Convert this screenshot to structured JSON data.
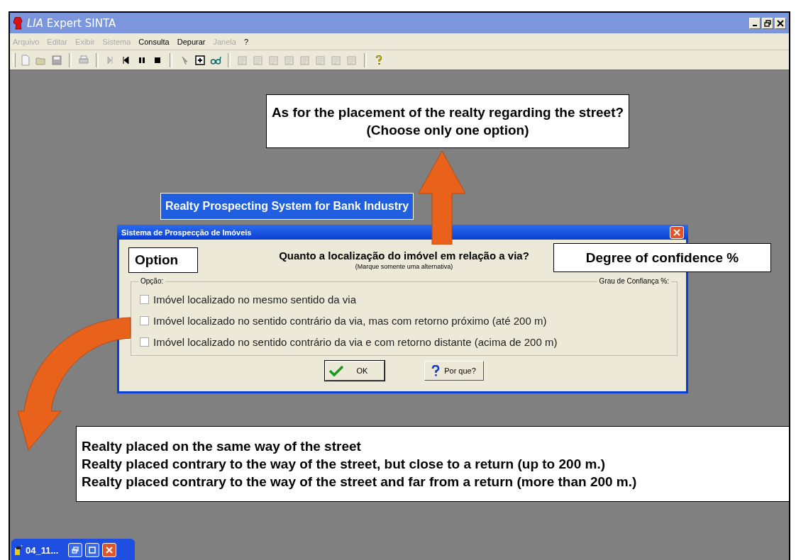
{
  "window": {
    "title": "*LIA* Expert SINTA"
  },
  "menu": [
    {
      "label": "Arquivo",
      "disabled": true
    },
    {
      "label": "Editar",
      "disabled": true
    },
    {
      "label": "Exibir",
      "disabled": true
    },
    {
      "label": "Sistema",
      "disabled": true
    },
    {
      "label": "Consulta",
      "disabled": false
    },
    {
      "label": "Depurar",
      "disabled": false
    },
    {
      "label": "Janela",
      "disabled": true
    },
    {
      "label": "?",
      "disabled": false
    }
  ],
  "toolbar": [
    {
      "kind": "new"
    },
    {
      "kind": "open"
    },
    {
      "kind": "save"
    },
    {
      "kind": "sep"
    },
    {
      "kind": "print"
    },
    {
      "kind": "sep"
    },
    {
      "kind": "step"
    },
    {
      "kind": "back"
    },
    {
      "kind": "pause"
    },
    {
      "kind": "stop"
    },
    {
      "kind": "sep"
    },
    {
      "kind": "cursor"
    },
    {
      "kind": "plus"
    },
    {
      "kind": "glasses"
    },
    {
      "kind": "sep"
    },
    {
      "kind": "tool"
    },
    {
      "kind": "tool"
    },
    {
      "kind": "tool"
    },
    {
      "kind": "tool"
    },
    {
      "kind": "tool"
    },
    {
      "kind": "tool"
    },
    {
      "kind": "tool"
    },
    {
      "kind": "tool"
    },
    {
      "kind": "sep"
    },
    {
      "kind": "help"
    }
  ],
  "dialog": {
    "title": "Sistema de Prospecção de Imóveis",
    "question": "Quanto a localização do imóvel em relação a via?",
    "hint": "(Marque somente uma alternativa)",
    "group_label": "Opção:",
    "confidence_label": "Grau de Confiança %:",
    "options": [
      {
        "label": "Imóvel localizado no mesmo sentido da via",
        "checked": false
      },
      {
        "label": "Imóvel localizado no sentido contrário da via, mas com retorno próximo (até 200 m)",
        "checked": false
      },
      {
        "label": "Imóvel localizado no sentido contrário da via e com retorno distante (acima de 200 m)",
        "checked": false
      }
    ],
    "buttons": [
      {
        "label": "OK",
        "kind": "ok"
      },
      {
        "label": "Por que?",
        "kind": "why"
      }
    ]
  },
  "annotations": {
    "question": [
      "As for the placement of the realty regarding the street?",
      "(Choose only one option)"
    ],
    "system_label": "Realty Prospecting System for Bank Industry",
    "option_label": "Option",
    "confidence_label": "Degree of confidence %",
    "options": [
      "Realty placed on the same way of the street",
      "Realty placed contrary to the way of the street, but close to a return (up to 200 m.)",
      "Realty placed contrary to the way of the street and far from a return (more than 200 m.)"
    ]
  },
  "minimized_window": {
    "title": "04_11..."
  }
}
